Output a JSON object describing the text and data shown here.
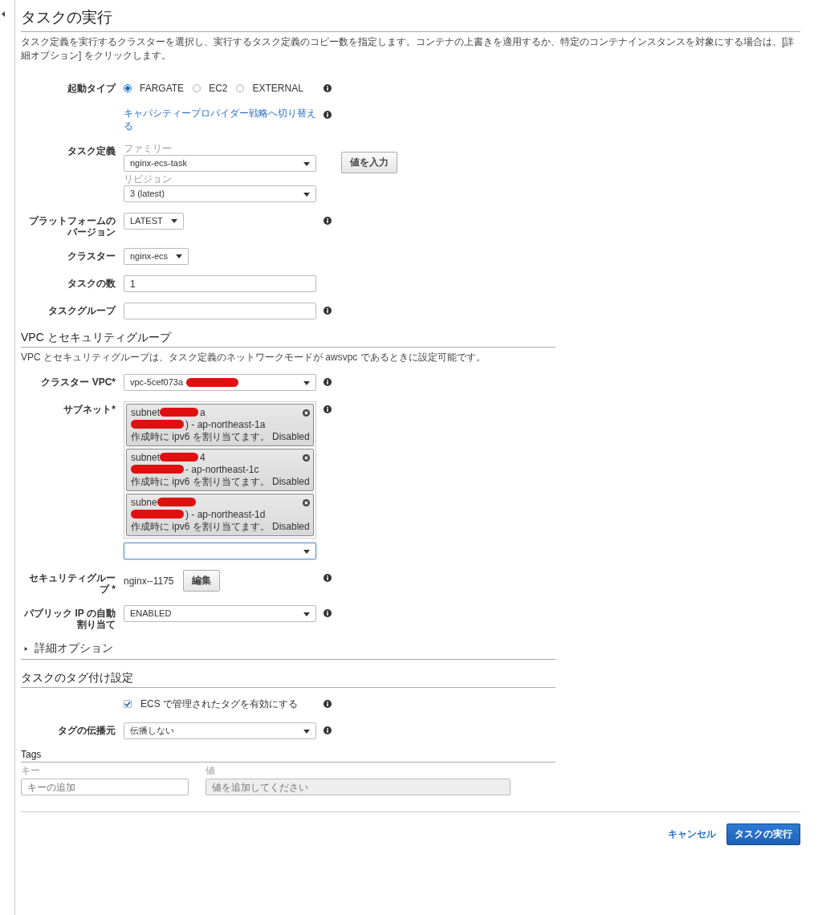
{
  "title": "タスクの実行",
  "description": "タスク定義を実行するクラスターを選択し、実行するタスク定義のコピー数を指定します。コンテナの上書きを適用するか、特定のコンテナインスタンスを対象にする場合は、[詳細オプション] をクリックします。",
  "form_rows": [
    {
      "kind": "radio",
      "label": "起動タイプ",
      "info": true,
      "options": [
        {
          "label": "FARGATE",
          "selected": true
        },
        {
          "label": "EC2",
          "selected": false
        },
        {
          "label": "EXTERNAL",
          "selected": false
        }
      ]
    },
    {
      "kind": "link",
      "text": "キャパシティープロバイダー戦略へ切り替える",
      "info": true
    },
    {
      "kind": "task_definition",
      "label": "タスク定義",
      "info": false,
      "family_label": "ファミリー",
      "family": "nginx-ecs-task",
      "revision_label": "リビジョン",
      "revision": "3 (latest)",
      "button": "値を入力"
    },
    {
      "kind": "small_select",
      "label": "プラットフォームのバージョン",
      "info": true,
      "value": "LATEST"
    },
    {
      "kind": "small_select",
      "label": "クラスター",
      "info": false,
      "value": "nginx-ecs"
    },
    {
      "kind": "input",
      "label": "タスクの数",
      "info": false,
      "value": "1"
    },
    {
      "kind": "input",
      "label": "タスクグループ",
      "info": true
    }
  ],
  "vpc_section": {
    "heading": "VPC とセキュリティグループ",
    "description": "VPC とセキュリティグループは、タスク定義のネットワークモードが awsvpc であるときに設定可能です。",
    "rows": [
      {
        "kind": "select",
        "label": "クラスター VPC*",
        "info": true,
        "value": "vpc-5cef073a",
        "redacted": true
      },
      {
        "kind": "subnets",
        "label": "サブネット*",
        "info": true,
        "items": [
          {
            "id_start": "subnet",
            "id_end": "a",
            "zone": ") - ap-northeast-1a",
            "ipv6": "作成時に ipv6 を割り当てます。 Disabled"
          },
          {
            "id_start": "subnet",
            "id_end": "4",
            "zone": "- ap-northeast-1c",
            "ipv6": "作成時に ipv6 を割り当てます。 Disabled"
          },
          {
            "id_start": "subne",
            "zone": ") - ap-northeast-1d",
            "ipv6": "作成時に ipv6 を割り当てます。 Disabled"
          }
        ]
      },
      {
        "kind": "security_group",
        "label": "セキュリティグループ *",
        "info": true,
        "value": "nginx--1175",
        "button": "編集"
      },
      {
        "kind": "select",
        "label": "パブリック IP の自動割り当て",
        "info": true,
        "value": "ENABLED",
        "redacted": false
      }
    ]
  },
  "advanced": {
    "label": "詳細オプション",
    "expanded": false
  },
  "tagging_section": {
    "heading": "タスクのタグ付け設定",
    "rows": [
      {
        "kind": "checkbox",
        "label": "ECS で管理されたタグを有効にする",
        "checked": true,
        "info": true
      },
      {
        "kind": "select",
        "label": "タグの伝播元",
        "info": true,
        "value": "伝播しない",
        "redacted": false
      }
    ]
  },
  "tags": {
    "heading": "Tags",
    "key_label": "キー",
    "value_label": "値",
    "key_placeholder": "キーの追加",
    "value_placeholder": "値を追加してください"
  },
  "footer": {
    "cancel": "キャンセル",
    "submit": "タスクの実行"
  }
}
